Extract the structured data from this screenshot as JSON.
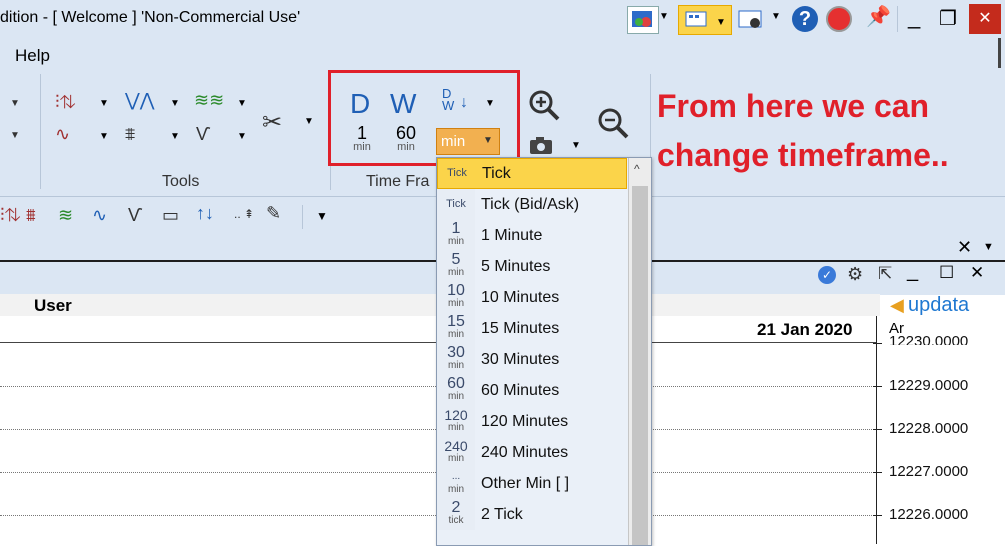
{
  "title": {
    "text": "dition -  [ Welcome ] 'Non-Commercial Use'"
  },
  "menu": {
    "help": "Help"
  },
  "window_controls": {
    "minimize": "_",
    "restore": "❐",
    "close": "✕"
  },
  "ribbon": {
    "tools_group_label": "Tools",
    "timeframe_group_label": "Time Fra",
    "day_label": "D",
    "week_label": "W",
    "dw_label": "D W",
    "min1_num": "1",
    "min60_num": "60",
    "min_unit": "min",
    "min_button": "min"
  },
  "chart": {
    "user_label": "User",
    "date_label": "21 Jan 2020",
    "axis_label": "Ar",
    "axis_values": [
      "12230.0000",
      "12229.0000",
      "12228.0000",
      "12227.0000",
      "12226.0000"
    ],
    "brand": "updata"
  },
  "dropdown": {
    "items": [
      {
        "icon_top": "Tick",
        "icon_unit": "",
        "label": "Tick",
        "selected": true
      },
      {
        "icon_top": "Tick",
        "icon_unit": "",
        "label": "Tick (Bid/Ask)"
      },
      {
        "icon_top": "1",
        "icon_unit": "min",
        "label": "1 Minute"
      },
      {
        "icon_top": "5",
        "icon_unit": "min",
        "label": "5 Minutes"
      },
      {
        "icon_top": "10",
        "icon_unit": "min",
        "label": "10 Minutes"
      },
      {
        "icon_top": "15",
        "icon_unit": "min",
        "label": "15 Minutes"
      },
      {
        "icon_top": "30",
        "icon_unit": "min",
        "label": "30 Minutes"
      },
      {
        "icon_top": "60",
        "icon_unit": "min",
        "label": "60 Minutes"
      },
      {
        "icon_top": "120",
        "icon_unit": "min",
        "label": "120 Minutes"
      },
      {
        "icon_top": "240",
        "icon_unit": "min",
        "label": "240 Minutes"
      },
      {
        "icon_top": "...",
        "icon_unit": "min",
        "label": "Other Min [ ]"
      },
      {
        "icon_top": "2",
        "icon_unit": "tick",
        "label": "2 Tick"
      }
    ]
  },
  "annotation": {
    "line1": "From here we can",
    "line2": "change timeframe.."
  },
  "colors": {
    "accent_red": "#e0202a",
    "highlight": "#fbd44a",
    "ribbon_bg": "#dbe6f3",
    "icon_blue": "#1f5fb5"
  }
}
